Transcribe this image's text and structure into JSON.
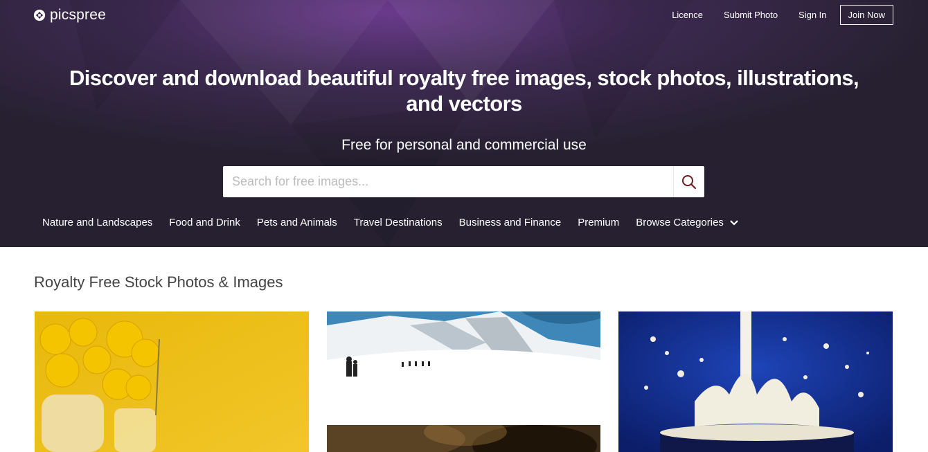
{
  "brand": {
    "name": "picspree"
  },
  "topnav": {
    "licence": "Licence",
    "submit_photo": "Submit Photo",
    "sign_in": "Sign In",
    "join_now": "Join Now"
  },
  "hero": {
    "headline": "Discover and download beautiful royalty free images, stock photos, illustrations, and vectors",
    "subline": "Free for personal and commercial use"
  },
  "search": {
    "placeholder": "Search for free images..."
  },
  "categories": [
    "Nature and Landscapes",
    "Food and Drink",
    "Pets and Animals",
    "Travel Destinations",
    "Business and Finance",
    "Premium",
    "Browse Categories"
  ],
  "section": {
    "title": "Royalty Free Stock Photos & Images"
  },
  "photos": [
    "yellow-flowers-vase-photo",
    "snow-mountain-hikers-photo",
    "dark-drink-photo",
    "milk-splash-photo"
  ]
}
